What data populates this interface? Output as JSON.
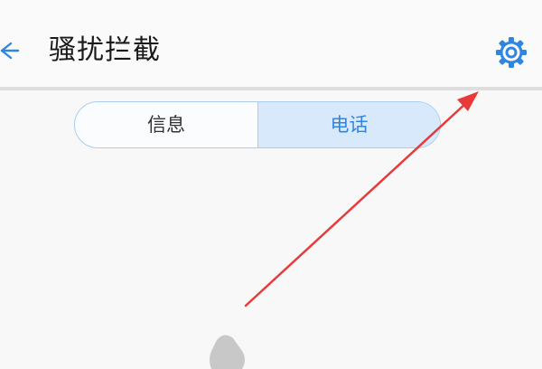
{
  "header": {
    "title": "骚扰拦截",
    "back_icon": "back-arrow-icon",
    "settings_icon": "gear-icon",
    "accent_color": "#2f86e0"
  },
  "tabs": [
    {
      "label": "信息",
      "selected": false
    },
    {
      "label": "电话",
      "selected": true
    }
  ],
  "annotation": {
    "arrow_color": "#e83a3a",
    "points_to": "settings-button"
  }
}
